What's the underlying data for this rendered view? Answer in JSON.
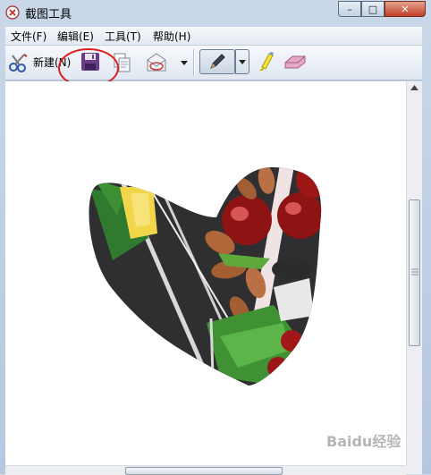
{
  "window": {
    "title": "截图工具",
    "controls": {
      "minimize": "–",
      "maximize": "□",
      "close": "✕"
    }
  },
  "menubar": {
    "items": [
      {
        "label": "文件(F)"
      },
      {
        "label": "编辑(E)"
      },
      {
        "label": "工具(T)"
      },
      {
        "label": "帮助(H)"
      }
    ]
  },
  "toolbar": {
    "new_label": "新建(N)",
    "icons": [
      "scissors-new-icon",
      "save-icon",
      "copy-icon",
      "send-snip-icon",
      "pen-icon",
      "highlighter-icon",
      "eraser-icon"
    ]
  },
  "annotation": {
    "color": "#e02020",
    "target": "save-button"
  },
  "colors": {
    "accent": "#3b5fa8",
    "frame": "#b6c8df",
    "close": "#c0402a"
  },
  "watermark": "Baidu经验"
}
